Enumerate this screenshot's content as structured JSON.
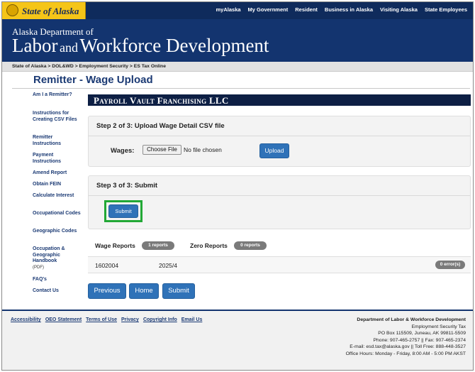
{
  "topbar": {
    "state_title": "State of Alaska",
    "nav": [
      "myAlaska",
      "My Government",
      "Resident",
      "Business in Alaska",
      "Visiting Alaska",
      "State Employees"
    ]
  },
  "header": {
    "line1": "Alaska Department of",
    "line2_a": "Labor",
    "line2_and": "and",
    "line2_b": "Workforce Development"
  },
  "breadcrumb": "State of Alaska > DOL&WD > Employment Security > ES Tax Online",
  "page_title": "Remitter - Wage Upload",
  "sidebar": {
    "items": [
      {
        "label": "Am I a Remitter?"
      },
      {
        "label": "Instructions for Creating CSV Files"
      },
      {
        "label": "Remitter Instructions"
      },
      {
        "label": "Payment Instructions"
      },
      {
        "label": "Amend Report"
      },
      {
        "label": "Obtain FEIN"
      },
      {
        "label": "Calculate Interest"
      },
      {
        "label": "Occupational Codes"
      },
      {
        "label": "Geographic Codes"
      },
      {
        "label": "Occupation & Geographic Handbook",
        "sub": "(PDF)"
      },
      {
        "label": "FAQ's"
      },
      {
        "label": "Contact Us"
      }
    ]
  },
  "employer_name": "Payroll Vault Franchising LLC",
  "step2": {
    "heading": "Step 2 of 3: Upload Wage Detail CSV file",
    "wages_label": "Wages:",
    "choose_file": "Choose File",
    "no_file": "No file chosen",
    "upload": "Upload"
  },
  "step3": {
    "heading": "Step 3 of 3: Submit",
    "submit": "Submit"
  },
  "reports": {
    "wage_label": "Wage Reports",
    "wage_count": "1 reports",
    "zero_label": "Zero Reports",
    "zero_count": "0 reports",
    "row": {
      "id": "1602004",
      "period": "2025/4",
      "errors": "0 error(s)"
    }
  },
  "buttons": {
    "previous": "Previous",
    "home": "Home",
    "submit": "Submit"
  },
  "footer": {
    "links": [
      "Accessibility",
      "OEO Statement",
      "Terms of Use",
      "Privacy",
      "Copyright Info",
      "Email Us"
    ],
    "info": {
      "dept": "Department of Labor & Workforce Development",
      "division": "Employment Security Tax",
      "address": "PO Box 115509, Juneau, AK 99811-5509",
      "phone": "Phone: 907-465-2757 || Fax: 907-465-2374",
      "email": "E-mail: esd.tax@alaska.gov || Toll Free: 888-448-3527",
      "hours": "Office Hours: Monday - Friday, 8:00 AM - 5:00 PM AKST"
    }
  },
  "colors": {
    "navy": "#13346f",
    "gold": "#f5c518",
    "button_blue": "#2f72b8",
    "highlight_green": "#22a836",
    "title_blue": "#1b3a74"
  },
  "icons": {
    "state_seal": "alaska-seal-icon"
  }
}
